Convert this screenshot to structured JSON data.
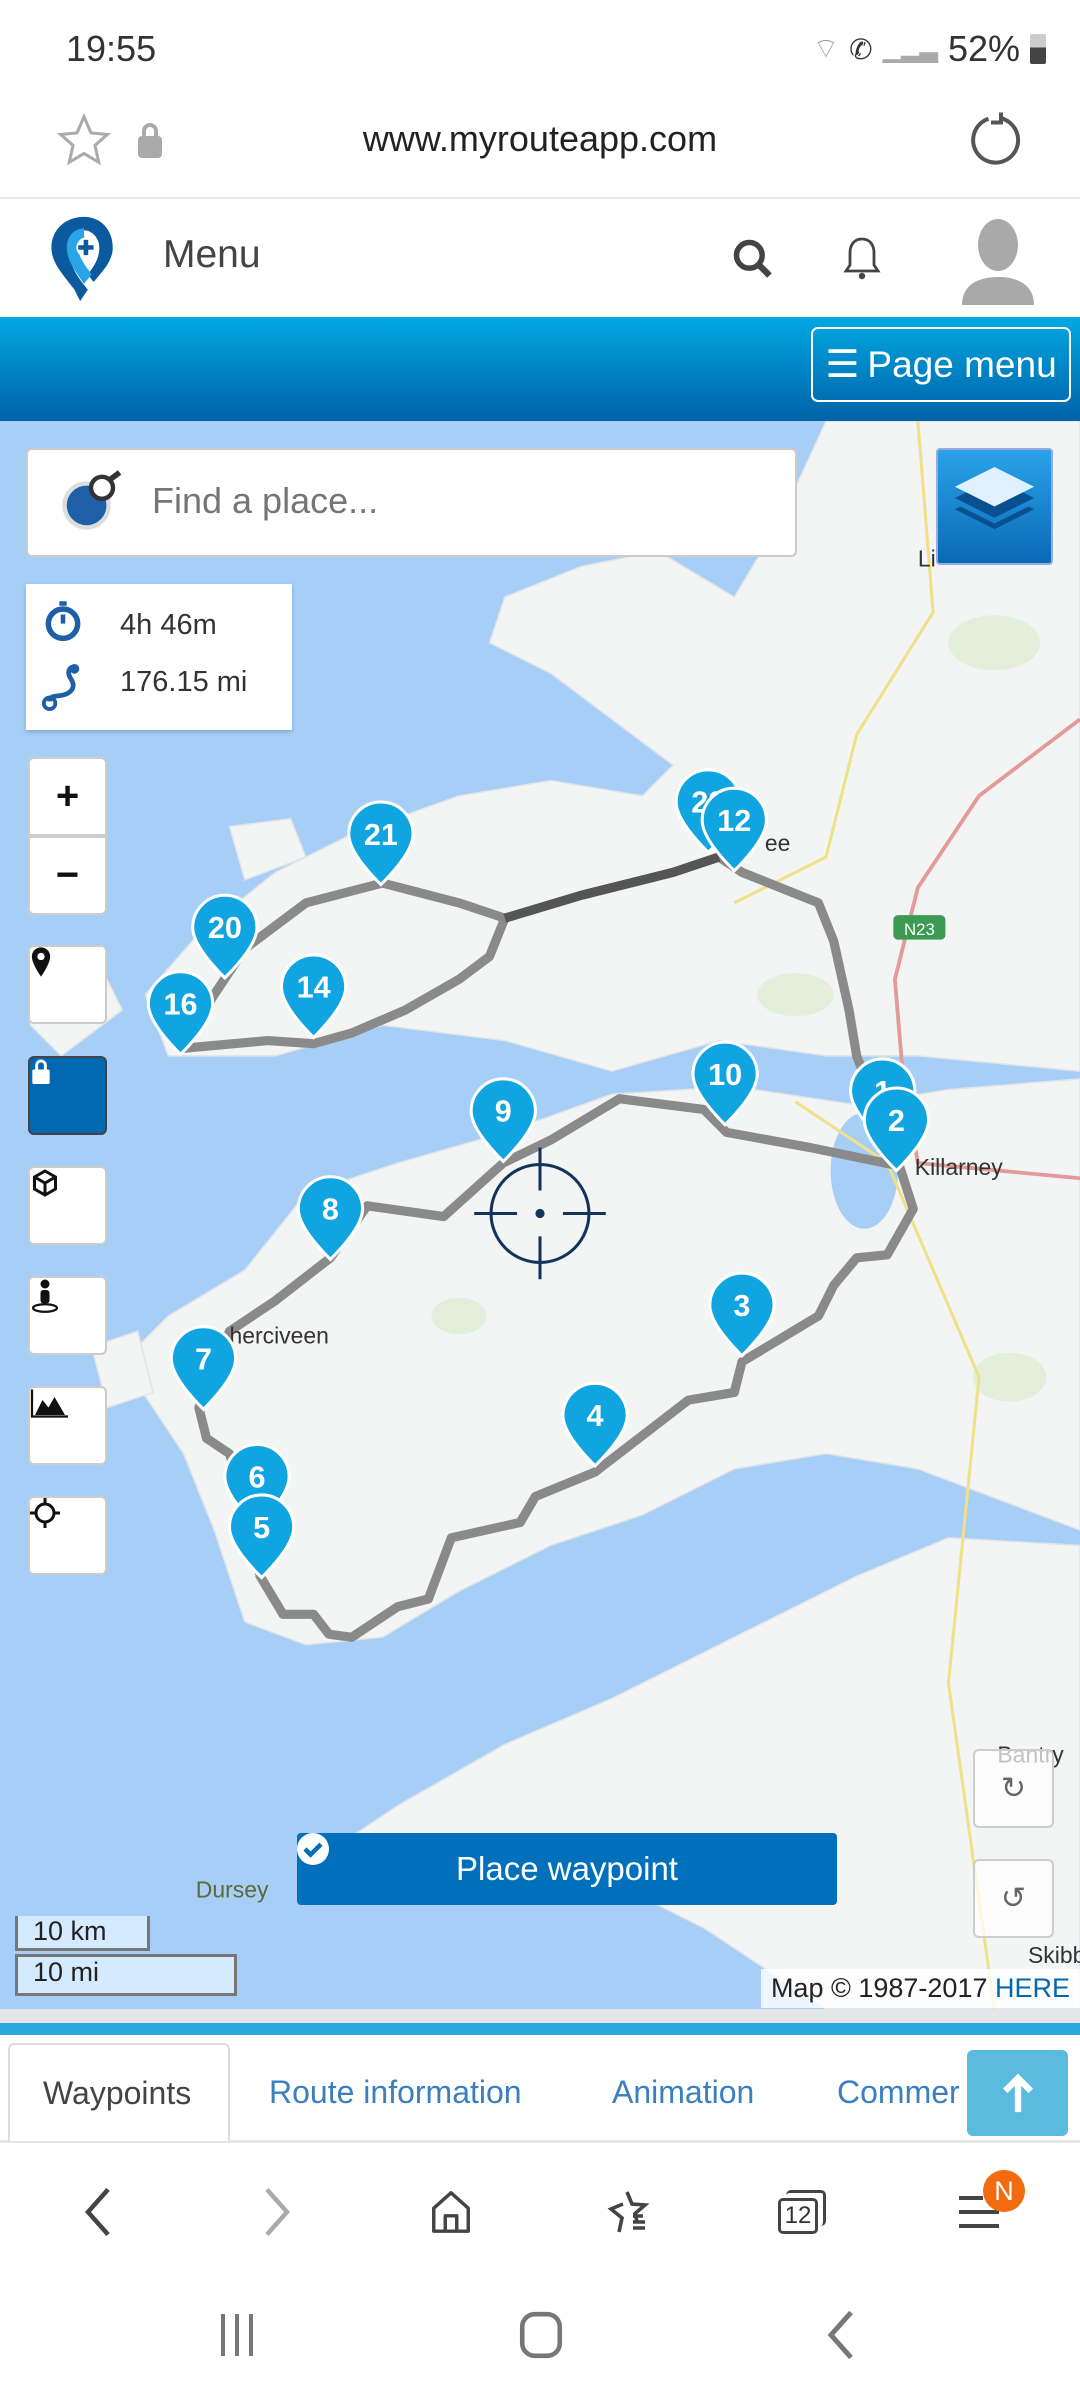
{
  "status": {
    "time": "19:55",
    "battery": "52%"
  },
  "browser": {
    "url": "www.myrouteapp.com",
    "tab_count": "12",
    "menu_badge": "N"
  },
  "header": {
    "menu_label": "Menu"
  },
  "toolbar": {
    "page_menu_label": "Page menu"
  },
  "search": {
    "placeholder": "Find a place..."
  },
  "route_summary": {
    "duration": "4h 46m",
    "distance": "176.15 mi"
  },
  "waypoints": [
    "21",
    "20",
    "16",
    "14",
    "22",
    "12",
    "9",
    "10",
    "1",
    "2",
    "8",
    "7",
    "3",
    "4",
    "6",
    "5"
  ],
  "map_labels": {
    "killarney": "Killarney",
    "cahersiveen": "herciveen",
    "bantry": "Bantry",
    "skibbereen": "Skibbere",
    "dursey": "Dursey",
    "tralee": "ee",
    "listowel": "Li",
    "road": "N23"
  },
  "place_waypoint_label": "Place waypoint",
  "scale": {
    "km": "10 km",
    "mi": "10 mi"
  },
  "attribution": {
    "text": "Map © 1987-2017 ",
    "link": "HERE"
  },
  "tabs": [
    {
      "label": "Waypoints",
      "active": true
    },
    {
      "label": "Route information"
    },
    {
      "label": "Animation"
    },
    {
      "label": "Commer"
    }
  ],
  "colors": {
    "accent": "#0070bd",
    "marker": "#10a4e0",
    "route": "#8a8a8a",
    "sea": "#a6cef6"
  }
}
